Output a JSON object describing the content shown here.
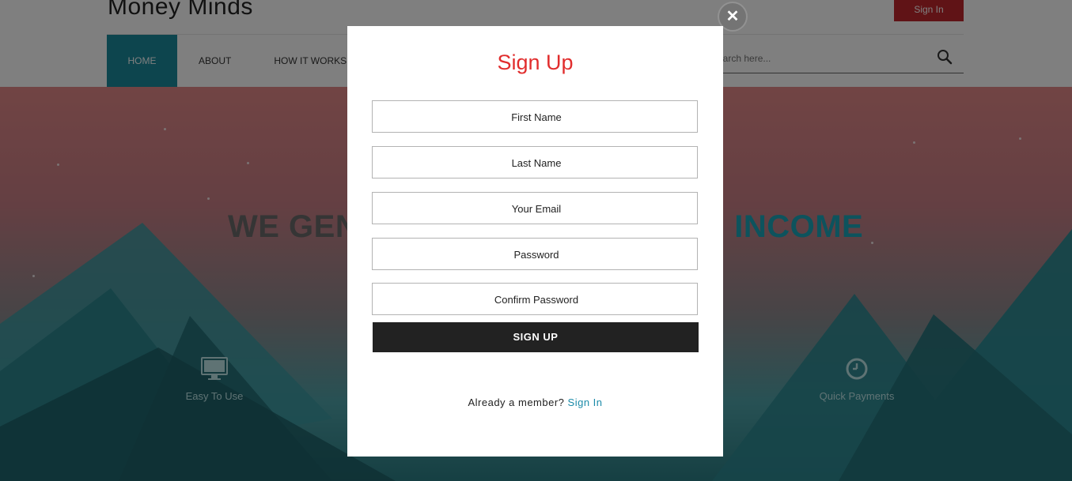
{
  "header": {
    "logo": "Money Minds",
    "signin_label": "Sign In",
    "search_placeholder": "earch here..."
  },
  "nav": {
    "items": [
      {
        "label": "HOME"
      },
      {
        "label": "ABOUT"
      },
      {
        "label": "HOW IT WORKS"
      }
    ]
  },
  "hero": {
    "title_left": "WE GEN",
    "title_right": "INCOME",
    "features": [
      {
        "label": "Easy To Use",
        "icon": "monitor-icon"
      },
      {
        "label": "Quick Payments",
        "icon": "clock-icon"
      }
    ]
  },
  "modal": {
    "title": "Sign Up",
    "fields": {
      "first_name": "First Name",
      "last_name": "Last Name",
      "email": "Your Email",
      "password": "Password",
      "confirm_password": "Confirm Password"
    },
    "submit_label": "SIGN UP",
    "member_text": "Already a member?",
    "member_link": "Sign In",
    "close_symbol": "✕"
  },
  "colors": {
    "accent": "#1a8a9c",
    "title_red": "#e12d2d",
    "button_dark": "#222222",
    "signin_red": "#c0262c"
  }
}
